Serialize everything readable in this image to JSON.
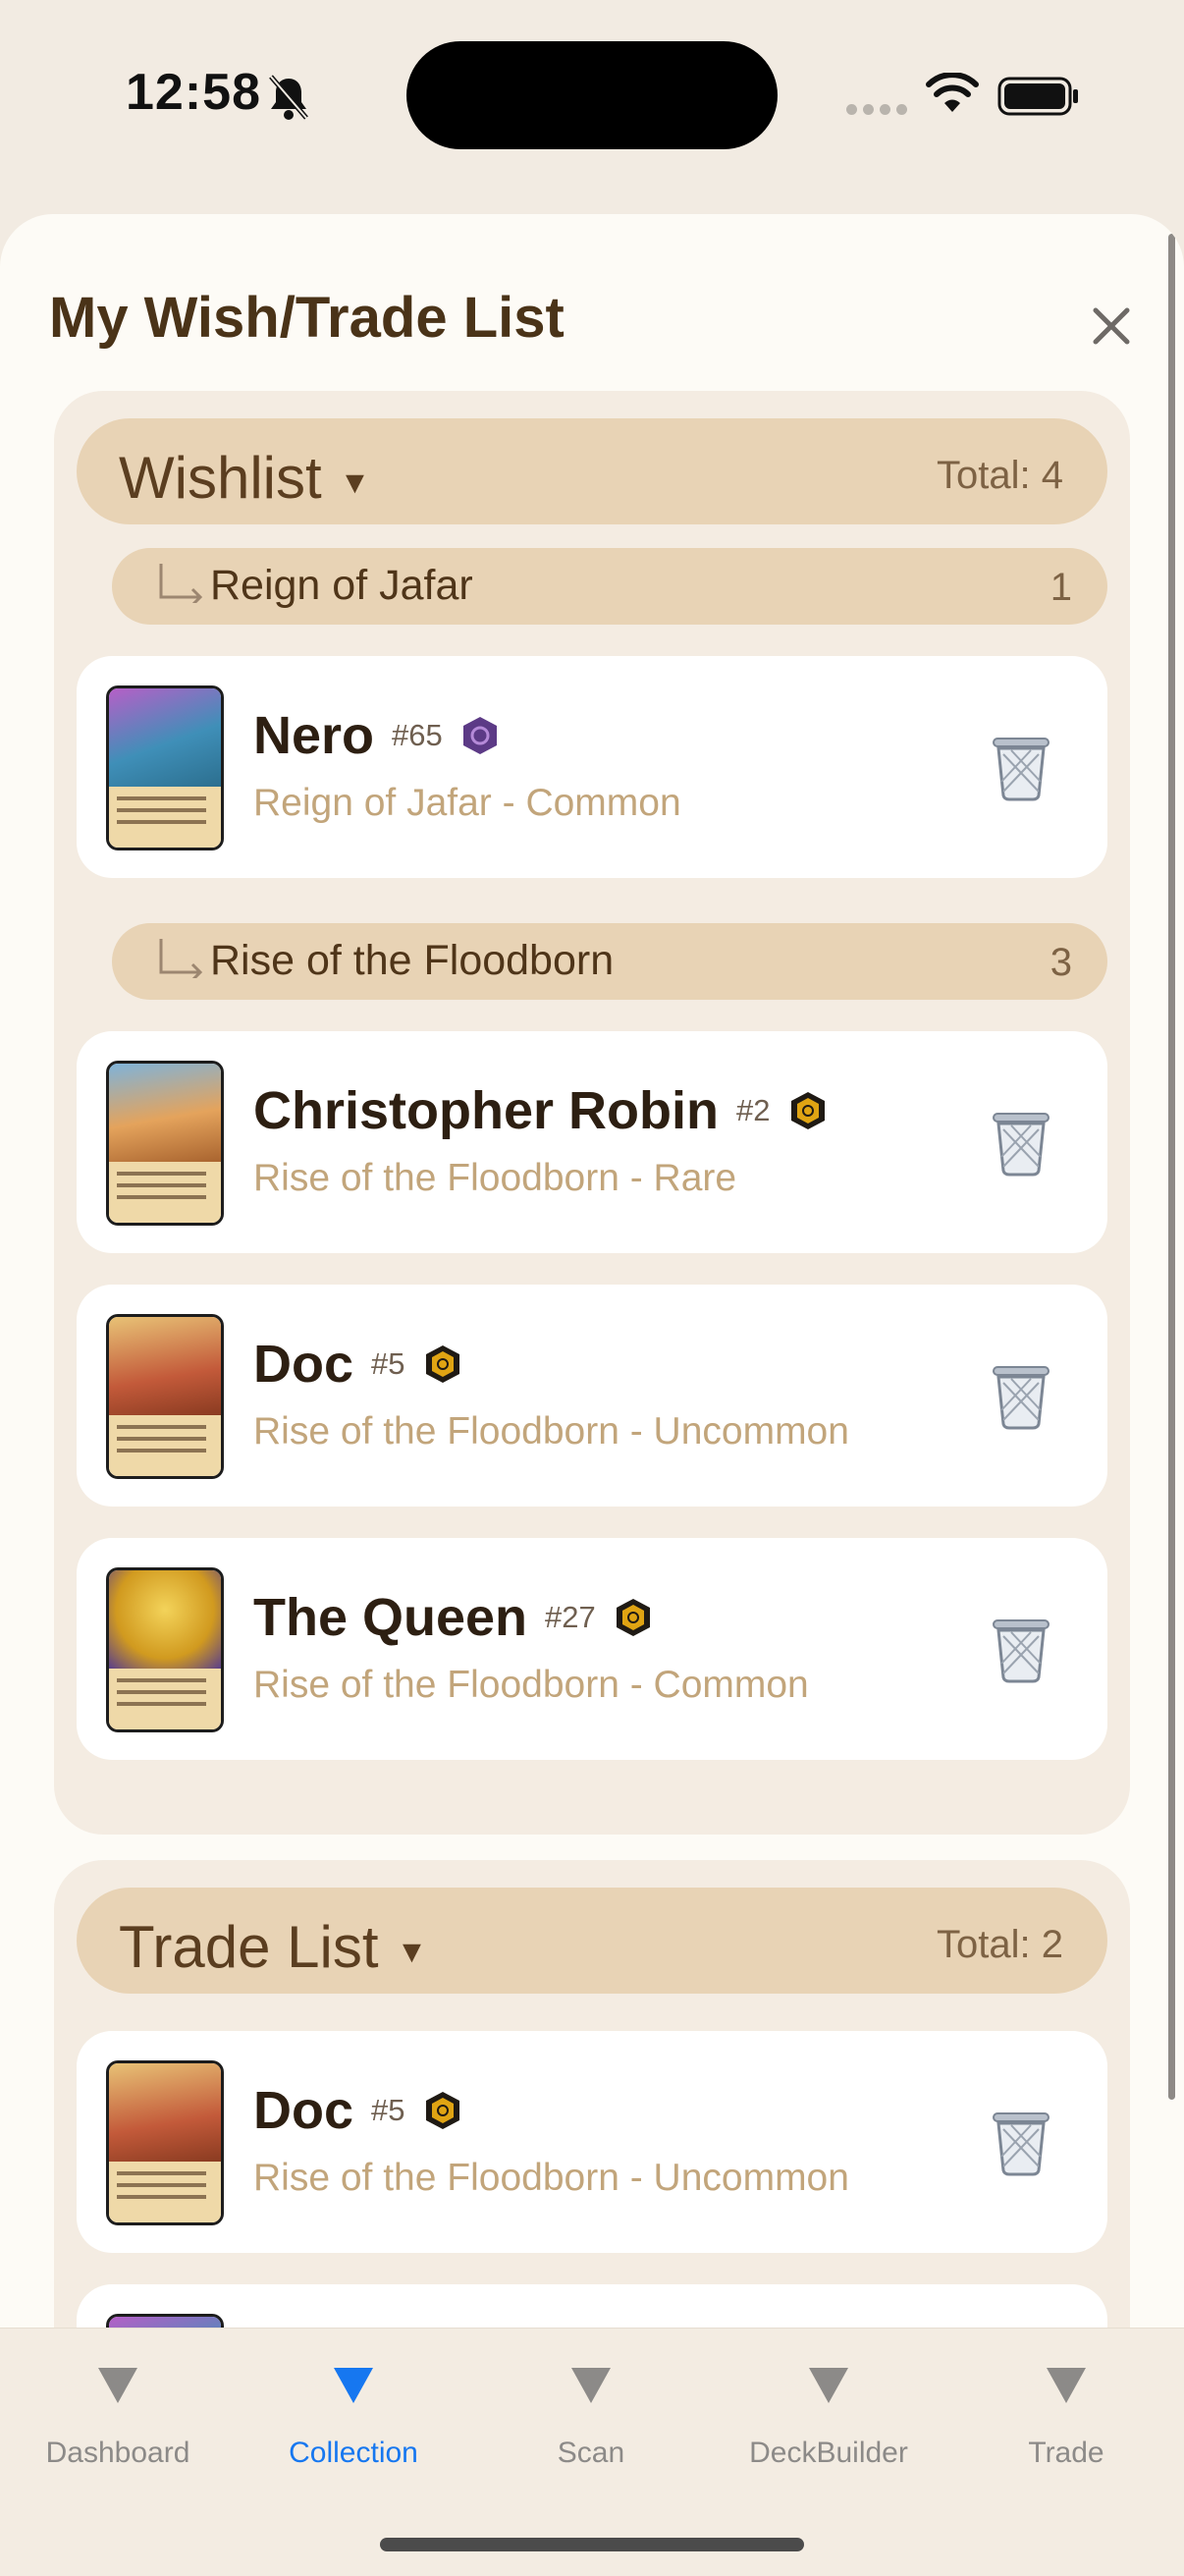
{
  "status": {
    "time": "12:58"
  },
  "sheet": {
    "title": "My Wish/Trade List"
  },
  "wishlist": {
    "title": "Wishlist",
    "total": "Total: 4",
    "groups": [
      {
        "title": "Reign of Jafar",
        "count": "1",
        "cards": [
          {
            "name": "Nero",
            "number": "#65",
            "subtitle": "Reign of Jafar - Common",
            "ink_color": "#5c3a86",
            "art_color": "#8b4fb6"
          }
        ]
      },
      {
        "title": "Rise of the Floodborn",
        "count": "3",
        "cards": [
          {
            "name": "Christopher Robin",
            "number": "#2",
            "subtitle": "Rise of the Floodborn - Rare",
            "ink_color": "#e0a413",
            "art_color": "#d79a55"
          },
          {
            "name": "Doc",
            "number": "#5",
            "subtitle": "Rise of the Floodborn - Uncommon",
            "ink_color": "#e0a413",
            "art_color": "#c9923b"
          },
          {
            "name": "The Queen",
            "number": "#27",
            "subtitle": "Rise of the Floodborn - Common",
            "ink_color": "#e0a413",
            "art_color": "#d8a826"
          }
        ]
      }
    ]
  },
  "tradelist": {
    "title": "Trade List",
    "total": "Total: 2",
    "cards": [
      {
        "name": "Doc",
        "number": "#5",
        "subtitle": "Rise of the Floodborn - Uncommon",
        "ink_color": "#e0a413",
        "art_color": "#c9923b"
      }
    ]
  },
  "tabs": [
    {
      "label": "Dashboard",
      "active": false
    },
    {
      "label": "Collection",
      "active": true
    },
    {
      "label": "Scan",
      "active": false
    },
    {
      "label": "DeckBuilder",
      "active": false
    },
    {
      "label": "Trade",
      "active": false
    }
  ],
  "colors": {
    "accent": "#1677f0",
    "header_fill": "#e8d3b5",
    "subtitle": "#c2a57b"
  }
}
